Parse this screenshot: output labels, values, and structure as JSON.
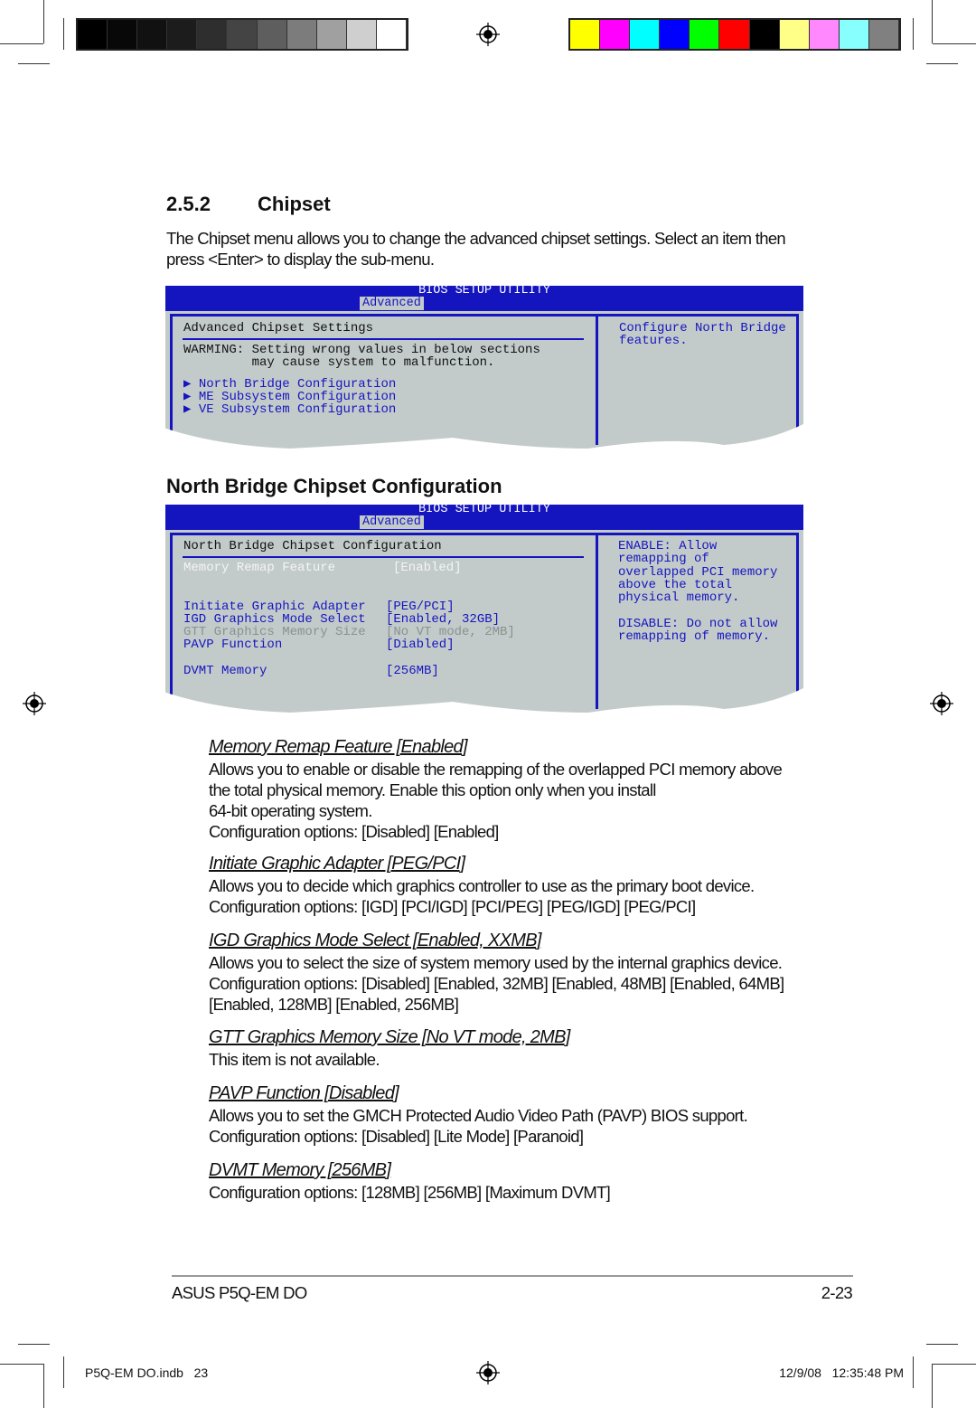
{
  "colors": {
    "bios_blue": "#1515c0",
    "bios_gray": "#c3cbca",
    "gray_swatches": [
      "#000000",
      "#080808",
      "#111111",
      "#1c1c1c",
      "#2e2e2e",
      "#444444",
      "#5e5e5e",
      "#7c7c7c",
      "#a0a0a0",
      "#cfcfcf",
      "#ffffff"
    ],
    "color_swatches": [
      "#ffff00",
      "#ff00ff",
      "#00ffff",
      "#0000ff",
      "#00ff00",
      "#ff0000",
      "#000000",
      "#ffff88",
      "#ff88ff",
      "#88ffff",
      "#808080"
    ]
  },
  "section": {
    "number": "2.5.2",
    "title": "Chipset",
    "intro": "The Chipset menu allows you to change the advanced chipset settings. Select an item then press <Enter> to display the sub-menu."
  },
  "bios1": {
    "title": "BIOS SETUP UTILITY",
    "tab": "Advanced",
    "heading": "Advanced Chipset Settings",
    "warning1": "WARMING: Setting wrong values in below sections",
    "warning2": "         may cause system to malfunction.",
    "items": [
      "North Bridge Configuration",
      "ME Subsystem Configuration",
      "VE Subsystem Configuration"
    ],
    "help": [
      "Configure North Bridge",
      "features."
    ]
  },
  "nb_heading": "North Bridge Chipset Configuration",
  "bios2": {
    "title": "BIOS SETUP UTILITY",
    "tab": "Advanced",
    "heading": "North Bridge Chipset Configuration",
    "rows": [
      {
        "label": "Memory Remap Feature",
        "value": "[Enabled]"
      },
      {
        "label": "Initiate Graphic Adapter",
        "value": "[PEG/PCI]"
      },
      {
        "label": "IGD Graphics Mode Select",
        "value": "[Enabled, 32GB]"
      },
      {
        "label": "GTT Graphics Memory Size",
        "value": "[No VT mode, 2MB]"
      },
      {
        "label": "PAVP Function",
        "value": "[Diabled]"
      },
      {
        "label": "DVMT Memory",
        "value": "[256MB]"
      }
    ],
    "help": [
      "ENABLE: Allow",
      "remapping of",
      "overlapped PCI memory",
      "above the total",
      "physical memory.",
      "",
      "DISABLE: Do not allow",
      "remapping of memory."
    ]
  },
  "items": [
    {
      "title": "Memory Remap Feature [Enabled]",
      "lines": [
        "Allows you to enable or disable the remapping of the overlapped PCI memory above",
        "the total physical memory. Enable this option only when you install",
        "64-bit operating system.",
        "Configuration options: [Disabled] [Enabled]"
      ]
    },
    {
      "title": "Initiate Graphic Adapter [PEG/PCI]",
      "lines": [
        "Allows you to decide which graphics controller to use as the primary boot device.",
        "Configuration options: [IGD] [PCI/IGD] [PCI/PEG] [PEG/IGD] [PEG/PCI]"
      ]
    },
    {
      "title": "IGD Graphics Mode Select [Enabled, XXMB]",
      "lines": [
        "Allows you to select the size of system memory used by the internal graphics device.",
        "Configuration options: [Disabled] [Enabled, 32MB] [Enabled, 48MB] [Enabled, 64MB]",
        "[Enabled, 128MB] [Enabled, 256MB]"
      ]
    },
    {
      "title": "GTT Graphics Memory Size [No VT mode, 2MB]",
      "lines": [
        "This item is not available."
      ]
    },
    {
      "title": "PAVP Function [Disabled]",
      "lines": [
        "Allows you to set the GMCH Protected Audio Video Path (PAVP) BIOS support.",
        "Configuration options: [Disabled] [Lite Mode] [Paranoid]"
      ]
    },
    {
      "title": "DVMT Memory [256MB]",
      "lines": [
        "Configuration options: [128MB] [256MB] [Maximum DVMT]"
      ]
    }
  ],
  "footer": {
    "left": "ASUS P5Q-EM DO",
    "right": "2-23"
  },
  "slug": {
    "file": "P5Q-EM DO.indb   23",
    "date": "12/9/08   12:35:48 PM"
  }
}
